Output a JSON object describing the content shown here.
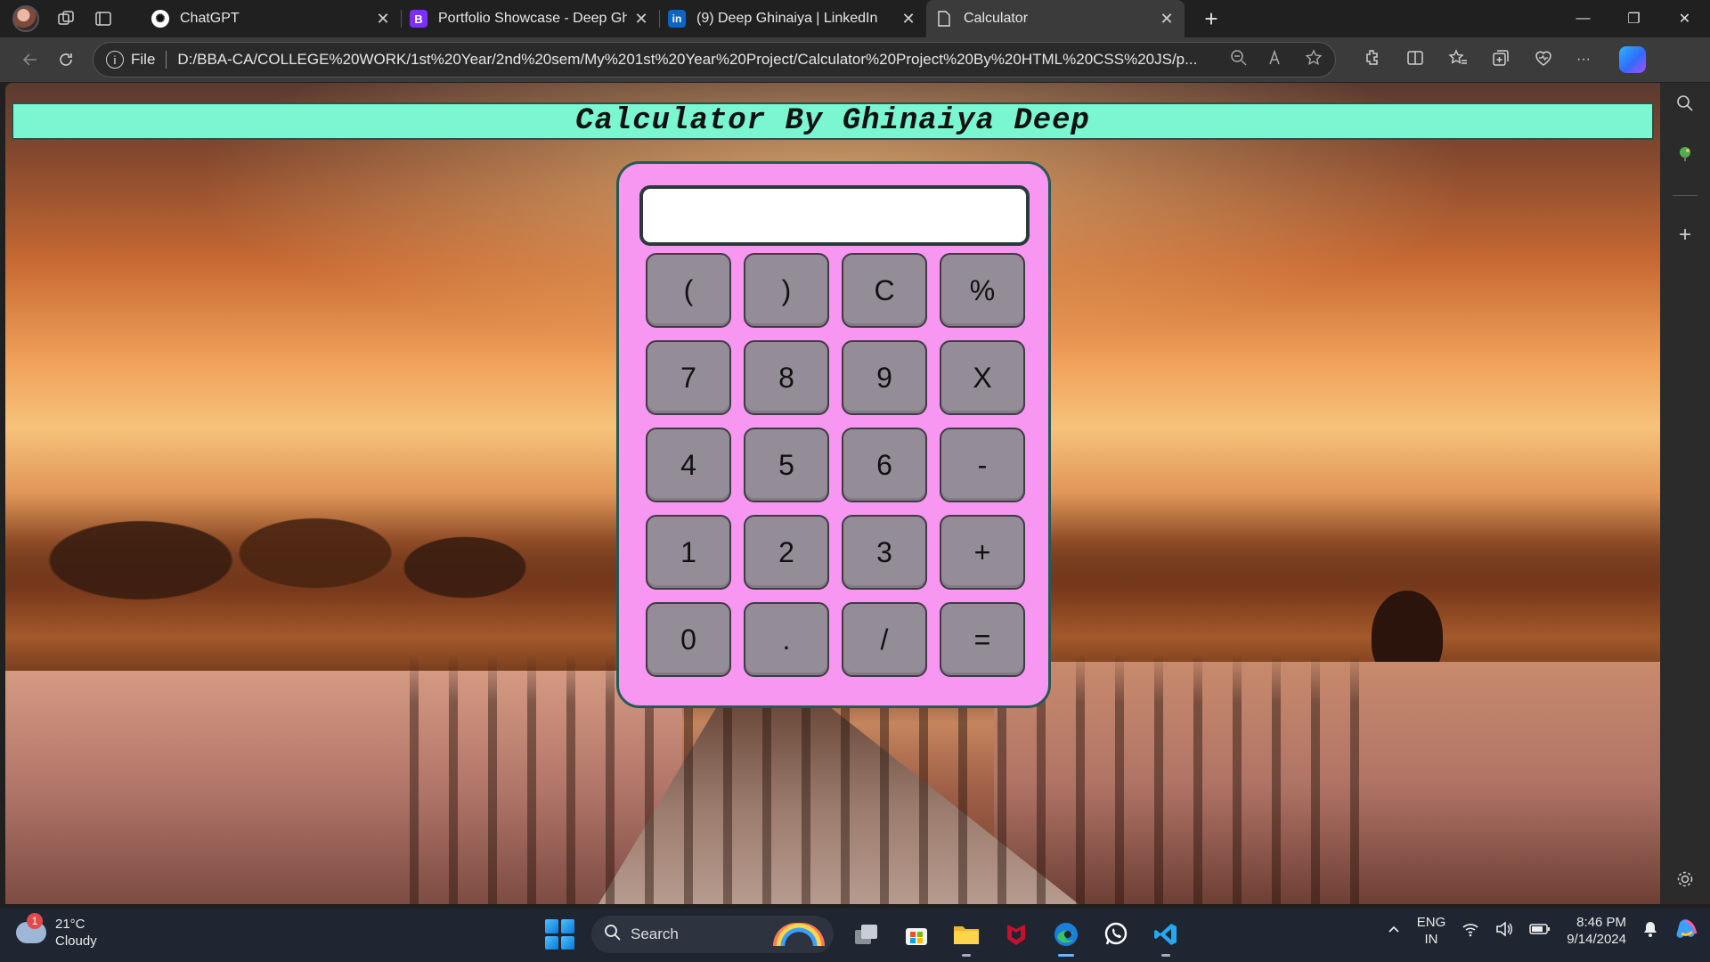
{
  "browser": {
    "tabs": [
      {
        "title": "ChatGPT",
        "icon": "chatgpt-icon",
        "active": false
      },
      {
        "title": "Portfolio Showcase - Deep Ghinaiya",
        "icon": "bootstrap-icon",
        "active": false
      },
      {
        "title": "(9) Deep Ghinaiya | LinkedIn",
        "icon": "linkedin-icon",
        "active": false
      },
      {
        "title": "Calculator",
        "icon": "page-icon",
        "active": true
      }
    ],
    "address": {
      "scheme_label": "File",
      "url": "D:/BBA-CA/COLLEGE%20WORK/1st%20Year/2nd%20sem/My%201st%20Year%20Project/Calculator%20Project%20By%20HTML%20CSS%20JS/p..."
    }
  },
  "app": {
    "header_title": "Calculator By Ghinaiya Deep",
    "display_value": "",
    "keys": [
      "(",
      ")",
      "C",
      "%",
      "7",
      "8",
      "9",
      "X",
      "4",
      "5",
      "6",
      "-",
      "1",
      "2",
      "3",
      "+",
      "0",
      ".",
      "/",
      "="
    ]
  },
  "taskbar": {
    "weather": {
      "temp": "21°C",
      "condition": "Cloudy",
      "badge": "1"
    },
    "search_placeholder": "Search",
    "language": {
      "line1": "ENG",
      "line2": "IN"
    },
    "clock": {
      "time": "8:46 PM",
      "date": "9/14/2024"
    }
  },
  "colors": {
    "header_bg": "#7af6d1",
    "calculator_body": "#f797f1",
    "key_bg": "#948d98",
    "display_bg": "#ffffff"
  }
}
